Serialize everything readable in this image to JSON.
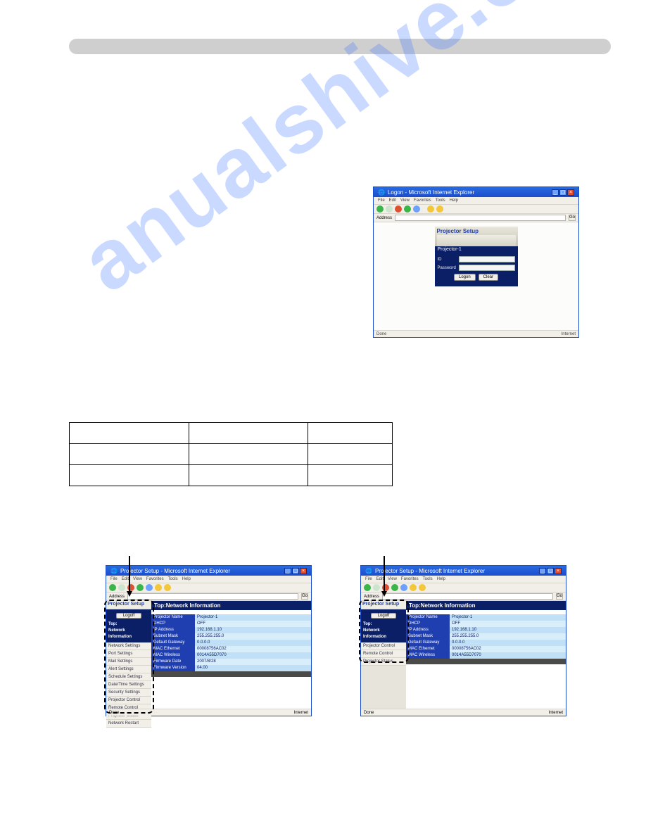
{
  "wm": "anualshive.co",
  "cred_headers": {
    "c1": "",
    "c2": "",
    "c3": ""
  },
  "cred_rows": [
    {
      "c1": "",
      "c2": "",
      "c3": ""
    },
    {
      "c1": "",
      "c2": "",
      "c3": ""
    }
  ],
  "ie_common": {
    "menu": [
      "File",
      "Edit",
      "View",
      "Favorites",
      "Tools",
      "Help"
    ],
    "status_left": "Done",
    "status_right": "Internet"
  },
  "ss1": {
    "title": "Logon - Microsoft Internet Explorer",
    "setup_label": "Projector Setup",
    "projector_subtitle": "Projector-1",
    "id_label": "ID",
    "pw_label": "Password",
    "btn_logon": "Logon",
    "btn_clear": "Clear"
  },
  "ss2": {
    "title": "Projector Setup - Microsoft Internet Explorer",
    "setup_label": "Projector Setup",
    "page_title": "Top:Network Information",
    "logoff": "Logoff",
    "side_sel_lines": [
      "Top:",
      "Network",
      "Information"
    ],
    "side_items": [
      "Network Settings",
      "Port Settings",
      "Mail Settings",
      "Alert Settings",
      "Schedule Settings",
      "Date/Time Settings",
      "Security Settings",
      "Projector Control",
      "Remote Control",
      "Projector Status",
      "Network Restart"
    ],
    "rows": [
      {
        "k": "Projector Name",
        "v": "Projector-1"
      },
      {
        "k": "DHCP",
        "v": "OFF"
      },
      {
        "k": "IP Address",
        "v": "192.168.1.10"
      },
      {
        "k": "Subnet Mask",
        "v": "255.255.255.0"
      },
      {
        "k": "Default Gateway",
        "v": "0.0.0.0"
      },
      {
        "k": "MAC Ethernet",
        "v": "00008756AC02"
      },
      {
        "k": "MAC Wireless",
        "v": "0014A55D7070"
      },
      {
        "k": "Firmware Date",
        "v": "2007/8/28"
      },
      {
        "k": "Firmware Version",
        "v": "04.00"
      }
    ]
  },
  "ss3": {
    "title": "Projector Setup - Microsoft Internet Explorer",
    "setup_label": "Projector Setup",
    "page_title": "Top:Network Information",
    "logoff": "Logoff",
    "side_sel_lines": [
      "Top:",
      "Network",
      "Information"
    ],
    "side_items": [
      "Projector Control",
      "Remote Control",
      "Projector Status"
    ],
    "rows": [
      {
        "k": "Projector Name",
        "v": "Projector-1"
      },
      {
        "k": "DHCP",
        "v": "OFF"
      },
      {
        "k": "IP Address",
        "v": "192.168.1.10"
      },
      {
        "k": "Subnet Mask",
        "v": "255.255.255.0"
      },
      {
        "k": "Default Gateway",
        "v": "0.0.0.0"
      },
      {
        "k": "MAC Ethernet",
        "v": "00008756AC02"
      },
      {
        "k": "MAC Wireless",
        "v": "0014A55D7070"
      }
    ]
  }
}
